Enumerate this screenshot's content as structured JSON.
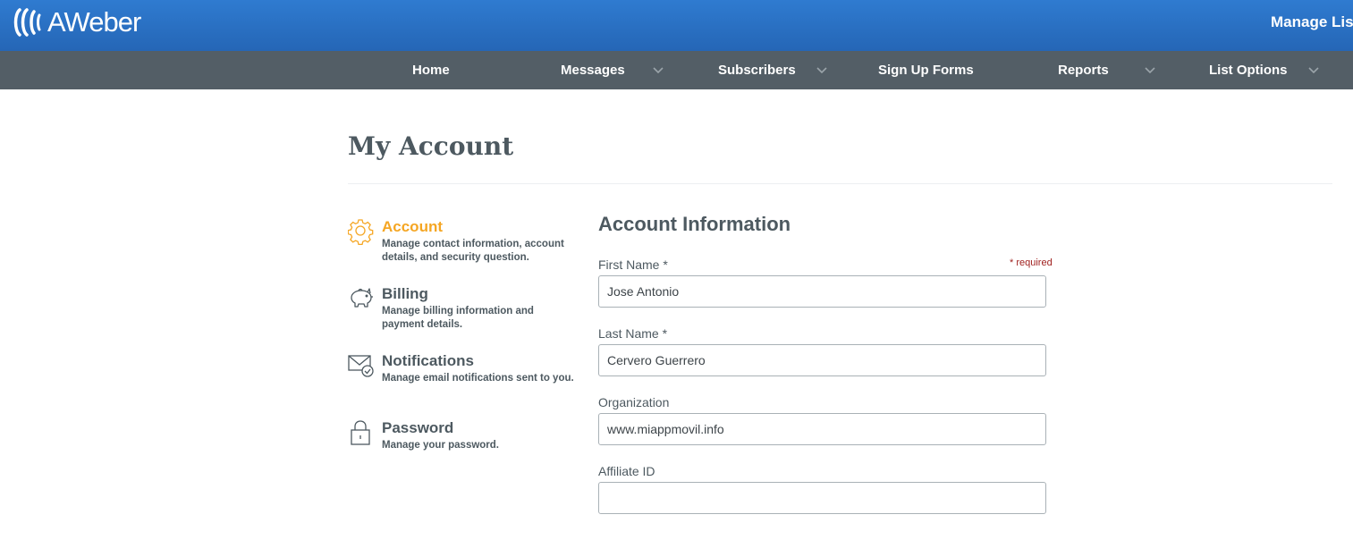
{
  "brand": {
    "name": "AWeber"
  },
  "header": {
    "manage_lists_label": "Manage Lists"
  },
  "nav": {
    "items": [
      {
        "label": "Home",
        "has_dropdown": false
      },
      {
        "label": "Messages",
        "has_dropdown": true
      },
      {
        "label": "Subscribers",
        "has_dropdown": true
      },
      {
        "label": "Sign Up Forms",
        "has_dropdown": false
      },
      {
        "label": "Reports",
        "has_dropdown": true
      },
      {
        "label": "List Options",
        "has_dropdown": true
      }
    ]
  },
  "page": {
    "title": "My Account"
  },
  "sidebar": {
    "items": [
      {
        "title": "Account",
        "description": "Manage contact information, account details, and security question.",
        "icon": "gear-icon",
        "active": true
      },
      {
        "title": "Billing",
        "description": "Manage billing information and payment details.",
        "icon": "piggy-bank-icon",
        "active": false
      },
      {
        "title": "Notifications",
        "description": "Manage email notifications sent to you.",
        "icon": "envelope-check-icon",
        "active": false
      },
      {
        "title": "Password",
        "description": "Manage your password.",
        "icon": "lock-icon",
        "active": false
      }
    ]
  },
  "form": {
    "title": "Account Information",
    "required_note": "* required",
    "fields": [
      {
        "label": "First Name *",
        "value": "Jose Antonio",
        "placeholder": ""
      },
      {
        "label": "Last Name *",
        "value": "Cervero Guerrero",
        "placeholder": ""
      },
      {
        "label": "Organization",
        "value": "www.miappmovil.info",
        "placeholder": ""
      },
      {
        "label": "Affiliate ID",
        "value": "",
        "placeholder": ""
      }
    ]
  },
  "colors": {
    "brand_blue": "#2a70c4",
    "nav_gray": "#535e66",
    "active_orange": "#f5a623",
    "required_red": "#a0211f"
  }
}
